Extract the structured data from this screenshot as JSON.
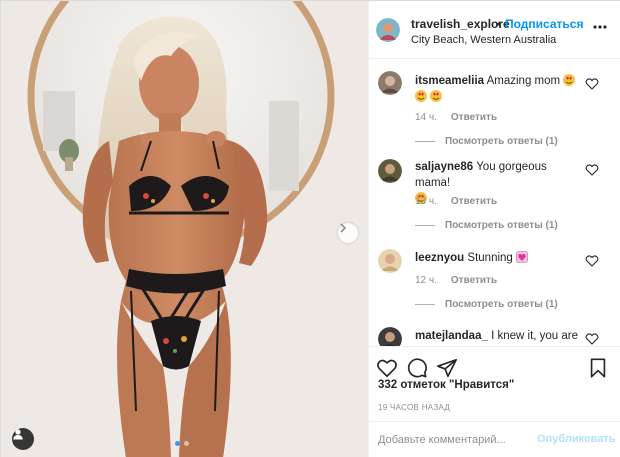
{
  "post": {
    "username": "travelish_explore",
    "bullet": "•",
    "follow_label": "Подписаться",
    "location": "City Beach, Western Australia",
    "more_icon": "more-horizontal-icon"
  },
  "comments": [
    {
      "username": "itsmeameliia",
      "text": "Amazing mom",
      "emoji": [
        "heart-eyes-emoji",
        "heart-eyes-emoji",
        "heart-eyes-emoji"
      ],
      "time": "14 ч.",
      "reply_label": "Ответить",
      "view_replies": "Посмотреть ответы (1)"
    },
    {
      "username": "saljayne86",
      "text": "You gorgeous mama!",
      "emoji": [
        "heart-eyes-emoji"
      ],
      "time": "13 ч.",
      "reply_label": "Ответить",
      "view_replies": "Посмотреть ответы (1)"
    },
    {
      "username": "leeznyou",
      "text": "Stunning",
      "emoji": [
        "sparkling-heart-emoji"
      ],
      "time": "12 ч.",
      "reply_label": "Ответить",
      "view_replies": "Посмотреть ответы (1)"
    },
    {
      "username": "matejlandaa_",
      "text": "I knew it, you are"
    }
  ],
  "actions": {
    "like_icon": "heart-outline-icon",
    "comment_icon": "comment-bubble-icon",
    "share_icon": "paper-plane-icon",
    "save_icon": "bookmark-icon",
    "likes_text": "332 отметок \"Нравится\"",
    "time_ago": "19 ЧАСОВ НАЗАД"
  },
  "add_comment": {
    "placeholder": "Добавьте комментарий...",
    "publish_label": "Опубликовать"
  },
  "colors": {
    "link_blue": "#0095f6",
    "publish_disabled": "#b2dffc",
    "muted": "#8e8e8e",
    "text": "#262626"
  }
}
